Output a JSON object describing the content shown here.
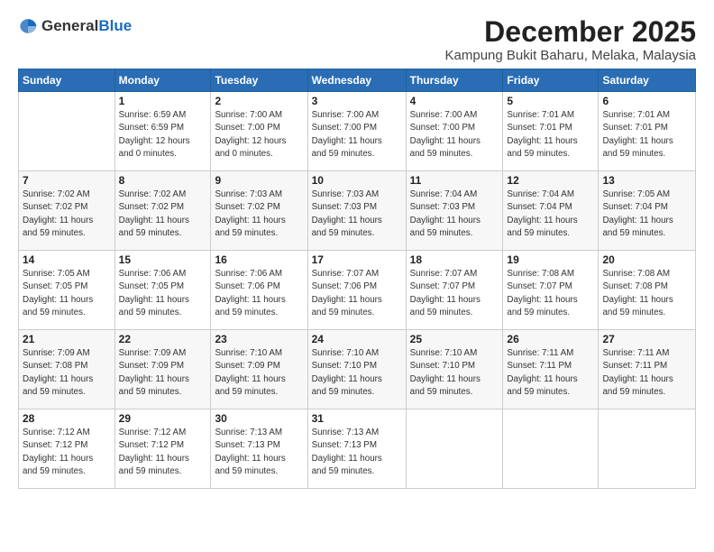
{
  "header": {
    "logo_general": "General",
    "logo_blue": "Blue",
    "month": "December 2025",
    "location": "Kampung Bukit Baharu, Melaka, Malaysia"
  },
  "days_of_week": [
    "Sunday",
    "Monday",
    "Tuesday",
    "Wednesday",
    "Thursday",
    "Friday",
    "Saturday"
  ],
  "weeks": [
    [
      {
        "day": "",
        "info": ""
      },
      {
        "day": "1",
        "info": "Sunrise: 6:59 AM\nSunset: 6:59 PM\nDaylight: 12 hours\nand 0 minutes."
      },
      {
        "day": "2",
        "info": "Sunrise: 7:00 AM\nSunset: 7:00 PM\nDaylight: 12 hours\nand 0 minutes."
      },
      {
        "day": "3",
        "info": "Sunrise: 7:00 AM\nSunset: 7:00 PM\nDaylight: 11 hours\nand 59 minutes."
      },
      {
        "day": "4",
        "info": "Sunrise: 7:00 AM\nSunset: 7:00 PM\nDaylight: 11 hours\nand 59 minutes."
      },
      {
        "day": "5",
        "info": "Sunrise: 7:01 AM\nSunset: 7:01 PM\nDaylight: 11 hours\nand 59 minutes."
      },
      {
        "day": "6",
        "info": "Sunrise: 7:01 AM\nSunset: 7:01 PM\nDaylight: 11 hours\nand 59 minutes."
      }
    ],
    [
      {
        "day": "7",
        "info": "Sunrise: 7:02 AM\nSunset: 7:02 PM\nDaylight: 11 hours\nand 59 minutes."
      },
      {
        "day": "8",
        "info": "Sunrise: 7:02 AM\nSunset: 7:02 PM\nDaylight: 11 hours\nand 59 minutes."
      },
      {
        "day": "9",
        "info": "Sunrise: 7:03 AM\nSunset: 7:02 PM\nDaylight: 11 hours\nand 59 minutes."
      },
      {
        "day": "10",
        "info": "Sunrise: 7:03 AM\nSunset: 7:03 PM\nDaylight: 11 hours\nand 59 minutes."
      },
      {
        "day": "11",
        "info": "Sunrise: 7:04 AM\nSunset: 7:03 PM\nDaylight: 11 hours\nand 59 minutes."
      },
      {
        "day": "12",
        "info": "Sunrise: 7:04 AM\nSunset: 7:04 PM\nDaylight: 11 hours\nand 59 minutes."
      },
      {
        "day": "13",
        "info": "Sunrise: 7:05 AM\nSunset: 7:04 PM\nDaylight: 11 hours\nand 59 minutes."
      }
    ],
    [
      {
        "day": "14",
        "info": "Sunrise: 7:05 AM\nSunset: 7:05 PM\nDaylight: 11 hours\nand 59 minutes."
      },
      {
        "day": "15",
        "info": "Sunrise: 7:06 AM\nSunset: 7:05 PM\nDaylight: 11 hours\nand 59 minutes."
      },
      {
        "day": "16",
        "info": "Sunrise: 7:06 AM\nSunset: 7:06 PM\nDaylight: 11 hours\nand 59 minutes."
      },
      {
        "day": "17",
        "info": "Sunrise: 7:07 AM\nSunset: 7:06 PM\nDaylight: 11 hours\nand 59 minutes."
      },
      {
        "day": "18",
        "info": "Sunrise: 7:07 AM\nSunset: 7:07 PM\nDaylight: 11 hours\nand 59 minutes."
      },
      {
        "day": "19",
        "info": "Sunrise: 7:08 AM\nSunset: 7:07 PM\nDaylight: 11 hours\nand 59 minutes."
      },
      {
        "day": "20",
        "info": "Sunrise: 7:08 AM\nSunset: 7:08 PM\nDaylight: 11 hours\nand 59 minutes."
      }
    ],
    [
      {
        "day": "21",
        "info": "Sunrise: 7:09 AM\nSunset: 7:08 PM\nDaylight: 11 hours\nand 59 minutes."
      },
      {
        "day": "22",
        "info": "Sunrise: 7:09 AM\nSunset: 7:09 PM\nDaylight: 11 hours\nand 59 minutes."
      },
      {
        "day": "23",
        "info": "Sunrise: 7:10 AM\nSunset: 7:09 PM\nDaylight: 11 hours\nand 59 minutes."
      },
      {
        "day": "24",
        "info": "Sunrise: 7:10 AM\nSunset: 7:10 PM\nDaylight: 11 hours\nand 59 minutes."
      },
      {
        "day": "25",
        "info": "Sunrise: 7:10 AM\nSunset: 7:10 PM\nDaylight: 11 hours\nand 59 minutes."
      },
      {
        "day": "26",
        "info": "Sunrise: 7:11 AM\nSunset: 7:11 PM\nDaylight: 11 hours\nand 59 minutes."
      },
      {
        "day": "27",
        "info": "Sunrise: 7:11 AM\nSunset: 7:11 PM\nDaylight: 11 hours\nand 59 minutes."
      }
    ],
    [
      {
        "day": "28",
        "info": "Sunrise: 7:12 AM\nSunset: 7:12 PM\nDaylight: 11 hours\nand 59 minutes."
      },
      {
        "day": "29",
        "info": "Sunrise: 7:12 AM\nSunset: 7:12 PM\nDaylight: 11 hours\nand 59 minutes."
      },
      {
        "day": "30",
        "info": "Sunrise: 7:13 AM\nSunset: 7:13 PM\nDaylight: 11 hours\nand 59 minutes."
      },
      {
        "day": "31",
        "info": "Sunrise: 7:13 AM\nSunset: 7:13 PM\nDaylight: 11 hours\nand 59 minutes."
      },
      {
        "day": "",
        "info": ""
      },
      {
        "day": "",
        "info": ""
      },
      {
        "day": "",
        "info": ""
      }
    ]
  ]
}
